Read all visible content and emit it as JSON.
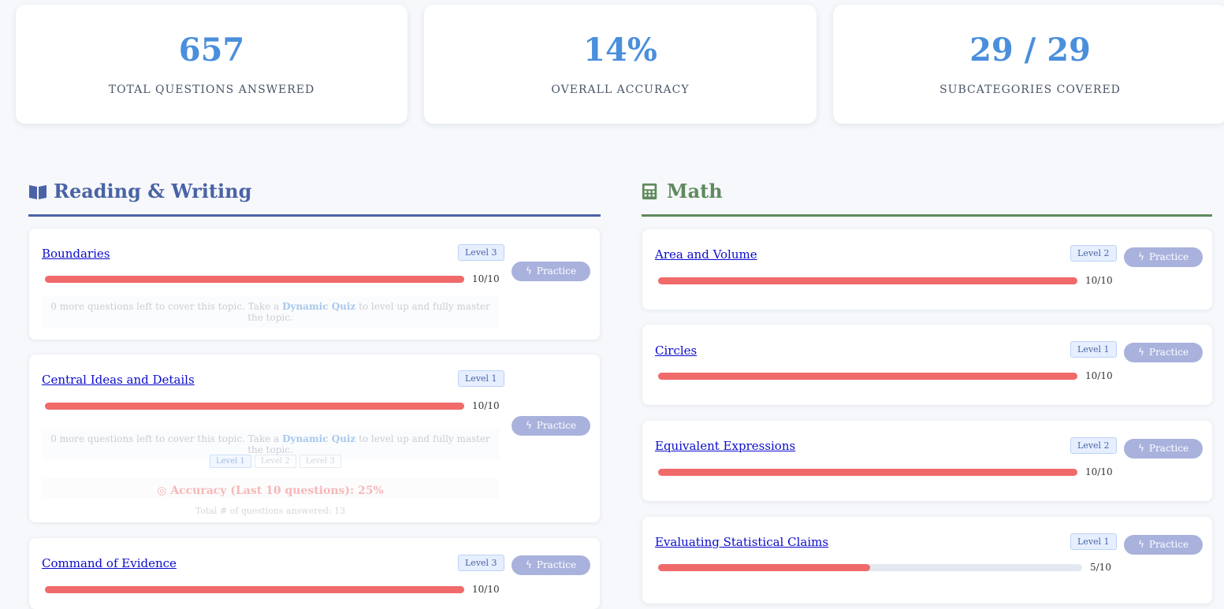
{
  "stats": [
    {
      "value": "657",
      "label": "TOTAL QUESTIONS ANSWERED"
    },
    {
      "value": "14%",
      "label": "OVERALL ACCURACY"
    },
    {
      "value": "29 / 29",
      "label": "SUBCATEGORIES COVERED"
    }
  ],
  "sections": {
    "reading_writing": {
      "title": "Reading & Writing",
      "icon": "book-open-icon",
      "color": "#4a63a6",
      "topics": [
        {
          "name": "Boundaries",
          "level": "Level 3",
          "count": "10/10",
          "progress": 1.0,
          "practice": "Practice",
          "note_prefix": "0 more questions left to cover this topic. Take a ",
          "note_link": "Dynamic Quiz",
          "note_suffix": " to level up and fully master the topic."
        },
        {
          "name": "Central Ideas and Details",
          "level": "Level 1",
          "count": "10/10",
          "progress": 1.0,
          "practice": "Practice",
          "note_prefix": "0 more questions left to cover this topic. Take a ",
          "note_link": "Dynamic Quiz",
          "note_suffix": " to level up and fully master the topic.",
          "levels": [
            "Level 1",
            "Level 2",
            "Level 3"
          ],
          "accuracy": "Accuracy (Last 10 questions): 25%",
          "total": "Total # of questions answered: 13"
        },
        {
          "name": "Command of Evidence",
          "level": "Level 3",
          "count": "10/10",
          "progress": 1.0,
          "practice": "Practice"
        }
      ]
    },
    "math": {
      "title": "Math",
      "icon": "calculator-icon",
      "color": "#5e8a5e",
      "topics": [
        {
          "name": "Area and Volume",
          "level": "Level 2",
          "count": "10/10",
          "progress": 1.0,
          "practice": "Practice"
        },
        {
          "name": "Circles",
          "level": "Level 1",
          "count": "10/10",
          "progress": 1.0,
          "practice": "Practice"
        },
        {
          "name": "Equivalent Expressions",
          "level": "Level 2",
          "count": "10/10",
          "progress": 1.0,
          "practice": "Practice"
        },
        {
          "name": "Evaluating Statistical Claims",
          "level": "Level 1",
          "count": "5/10",
          "progress": 0.5,
          "practice": "Practice"
        }
      ]
    }
  }
}
